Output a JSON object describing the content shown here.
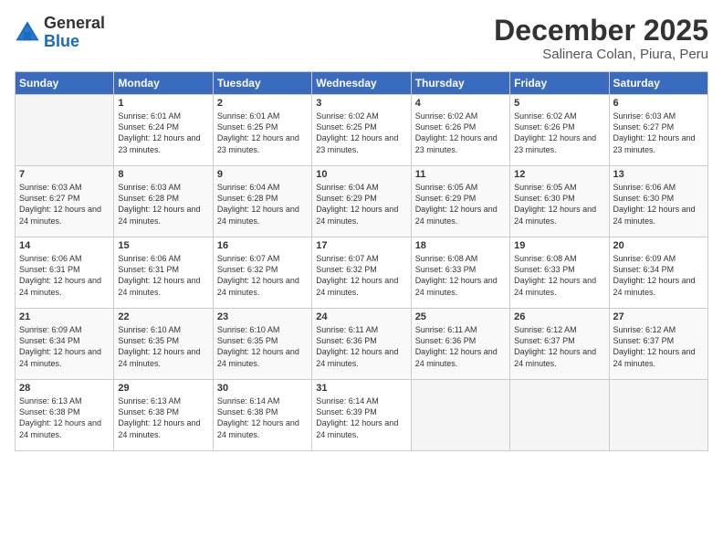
{
  "logo": {
    "general": "General",
    "blue": "Blue"
  },
  "title": "December 2025",
  "subtitle": "Salinera Colan, Piura, Peru",
  "headers": [
    "Sunday",
    "Monday",
    "Tuesday",
    "Wednesday",
    "Thursday",
    "Friday",
    "Saturday"
  ],
  "weeks": [
    [
      {
        "day": "",
        "sunrise": "",
        "sunset": "",
        "daylight": ""
      },
      {
        "day": "1",
        "sunrise": "Sunrise: 6:01 AM",
        "sunset": "Sunset: 6:24 PM",
        "daylight": "Daylight: 12 hours and 23 minutes."
      },
      {
        "day": "2",
        "sunrise": "Sunrise: 6:01 AM",
        "sunset": "Sunset: 6:25 PM",
        "daylight": "Daylight: 12 hours and 23 minutes."
      },
      {
        "day": "3",
        "sunrise": "Sunrise: 6:02 AM",
        "sunset": "Sunset: 6:25 PM",
        "daylight": "Daylight: 12 hours and 23 minutes."
      },
      {
        "day": "4",
        "sunrise": "Sunrise: 6:02 AM",
        "sunset": "Sunset: 6:26 PM",
        "daylight": "Daylight: 12 hours and 23 minutes."
      },
      {
        "day": "5",
        "sunrise": "Sunrise: 6:02 AM",
        "sunset": "Sunset: 6:26 PM",
        "daylight": "Daylight: 12 hours and 23 minutes."
      },
      {
        "day": "6",
        "sunrise": "Sunrise: 6:03 AM",
        "sunset": "Sunset: 6:27 PM",
        "daylight": "Daylight: 12 hours and 23 minutes."
      }
    ],
    [
      {
        "day": "7",
        "sunrise": "Sunrise: 6:03 AM",
        "sunset": "Sunset: 6:27 PM",
        "daylight": "Daylight: 12 hours and 24 minutes."
      },
      {
        "day": "8",
        "sunrise": "Sunrise: 6:03 AM",
        "sunset": "Sunset: 6:28 PM",
        "daylight": "Daylight: 12 hours and 24 minutes."
      },
      {
        "day": "9",
        "sunrise": "Sunrise: 6:04 AM",
        "sunset": "Sunset: 6:28 PM",
        "daylight": "Daylight: 12 hours and 24 minutes."
      },
      {
        "day": "10",
        "sunrise": "Sunrise: 6:04 AM",
        "sunset": "Sunset: 6:29 PM",
        "daylight": "Daylight: 12 hours and 24 minutes."
      },
      {
        "day": "11",
        "sunrise": "Sunrise: 6:05 AM",
        "sunset": "Sunset: 6:29 PM",
        "daylight": "Daylight: 12 hours and 24 minutes."
      },
      {
        "day": "12",
        "sunrise": "Sunrise: 6:05 AM",
        "sunset": "Sunset: 6:30 PM",
        "daylight": "Daylight: 12 hours and 24 minutes."
      },
      {
        "day": "13",
        "sunrise": "Sunrise: 6:06 AM",
        "sunset": "Sunset: 6:30 PM",
        "daylight": "Daylight: 12 hours and 24 minutes."
      }
    ],
    [
      {
        "day": "14",
        "sunrise": "Sunrise: 6:06 AM",
        "sunset": "Sunset: 6:31 PM",
        "daylight": "Daylight: 12 hours and 24 minutes."
      },
      {
        "day": "15",
        "sunrise": "Sunrise: 6:06 AM",
        "sunset": "Sunset: 6:31 PM",
        "daylight": "Daylight: 12 hours and 24 minutes."
      },
      {
        "day": "16",
        "sunrise": "Sunrise: 6:07 AM",
        "sunset": "Sunset: 6:32 PM",
        "daylight": "Daylight: 12 hours and 24 minutes."
      },
      {
        "day": "17",
        "sunrise": "Sunrise: 6:07 AM",
        "sunset": "Sunset: 6:32 PM",
        "daylight": "Daylight: 12 hours and 24 minutes."
      },
      {
        "day": "18",
        "sunrise": "Sunrise: 6:08 AM",
        "sunset": "Sunset: 6:33 PM",
        "daylight": "Daylight: 12 hours and 24 minutes."
      },
      {
        "day": "19",
        "sunrise": "Sunrise: 6:08 AM",
        "sunset": "Sunset: 6:33 PM",
        "daylight": "Daylight: 12 hours and 24 minutes."
      },
      {
        "day": "20",
        "sunrise": "Sunrise: 6:09 AM",
        "sunset": "Sunset: 6:34 PM",
        "daylight": "Daylight: 12 hours and 24 minutes."
      }
    ],
    [
      {
        "day": "21",
        "sunrise": "Sunrise: 6:09 AM",
        "sunset": "Sunset: 6:34 PM",
        "daylight": "Daylight: 12 hours and 24 minutes."
      },
      {
        "day": "22",
        "sunrise": "Sunrise: 6:10 AM",
        "sunset": "Sunset: 6:35 PM",
        "daylight": "Daylight: 12 hours and 24 minutes."
      },
      {
        "day": "23",
        "sunrise": "Sunrise: 6:10 AM",
        "sunset": "Sunset: 6:35 PM",
        "daylight": "Daylight: 12 hours and 24 minutes."
      },
      {
        "day": "24",
        "sunrise": "Sunrise: 6:11 AM",
        "sunset": "Sunset: 6:36 PM",
        "daylight": "Daylight: 12 hours and 24 minutes."
      },
      {
        "day": "25",
        "sunrise": "Sunrise: 6:11 AM",
        "sunset": "Sunset: 6:36 PM",
        "daylight": "Daylight: 12 hours and 24 minutes."
      },
      {
        "day": "26",
        "sunrise": "Sunrise: 6:12 AM",
        "sunset": "Sunset: 6:37 PM",
        "daylight": "Daylight: 12 hours and 24 minutes."
      },
      {
        "day": "27",
        "sunrise": "Sunrise: 6:12 AM",
        "sunset": "Sunset: 6:37 PM",
        "daylight": "Daylight: 12 hours and 24 minutes."
      }
    ],
    [
      {
        "day": "28",
        "sunrise": "Sunrise: 6:13 AM",
        "sunset": "Sunset: 6:38 PM",
        "daylight": "Daylight: 12 hours and 24 minutes."
      },
      {
        "day": "29",
        "sunrise": "Sunrise: 6:13 AM",
        "sunset": "Sunset: 6:38 PM",
        "daylight": "Daylight: 12 hours and 24 minutes."
      },
      {
        "day": "30",
        "sunrise": "Sunrise: 6:14 AM",
        "sunset": "Sunset: 6:38 PM",
        "daylight": "Daylight: 12 hours and 24 minutes."
      },
      {
        "day": "31",
        "sunrise": "Sunrise: 6:14 AM",
        "sunset": "Sunset: 6:39 PM",
        "daylight": "Daylight: 12 hours and 24 minutes."
      },
      {
        "day": "",
        "sunrise": "",
        "sunset": "",
        "daylight": ""
      },
      {
        "day": "",
        "sunrise": "",
        "sunset": "",
        "daylight": ""
      },
      {
        "day": "",
        "sunrise": "",
        "sunset": "",
        "daylight": ""
      }
    ]
  ]
}
